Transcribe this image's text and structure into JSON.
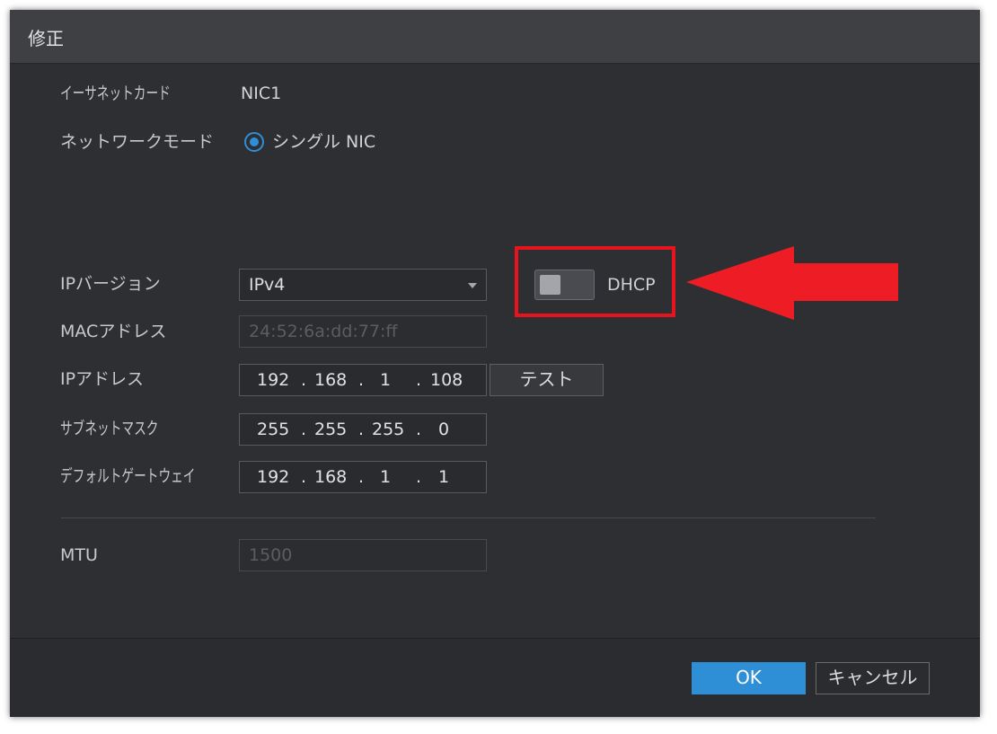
{
  "dialog": {
    "title": "修正"
  },
  "fields": {
    "ethernet_card": {
      "label": "イーサネットカード",
      "value": "NIC1"
    },
    "network_mode": {
      "label": "ネットワークモード",
      "option": "シングル NIC"
    },
    "ip_version": {
      "label": "IPバージョン",
      "value": "IPv4"
    },
    "dhcp": {
      "label": "DHCP",
      "enabled": false
    },
    "mac_address": {
      "label": "MACアドレス",
      "value": "24:52:6a:dd:77:ff"
    },
    "ip_address": {
      "label": "IPアドレス",
      "octets": [
        "192",
        "168",
        "1",
        "108"
      ]
    },
    "subnet_mask": {
      "label": "サブネットマスク",
      "octets": [
        "255",
        "255",
        "255",
        "0"
      ]
    },
    "default_gateway": {
      "label": "デフォルトゲートウェイ",
      "octets": [
        "192",
        "168",
        "1",
        "1"
      ]
    },
    "mtu": {
      "label": "MTU",
      "value": "1500"
    }
  },
  "buttons": {
    "test": "テスト",
    "ok": "OK",
    "cancel": "キャンセル"
  },
  "separator": ".",
  "colors": {
    "accent": "#2f8fd6",
    "ok_button": "#2f8fd6",
    "annotation": "#e8141d"
  }
}
